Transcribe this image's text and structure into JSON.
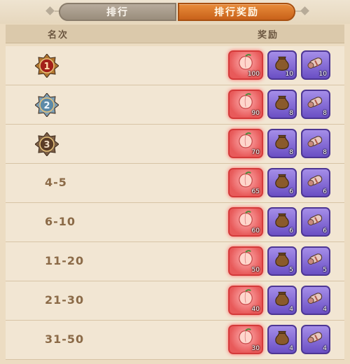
{
  "tabs": [
    {
      "label": "排行",
      "active": false
    },
    {
      "label": "排行奖励",
      "active": true
    }
  ],
  "header": {
    "rank": "名次",
    "reward": "奖励"
  },
  "rows": [
    {
      "rank": "1",
      "medal": "gold",
      "rewards": [
        {
          "icon": "peach-icon",
          "count": "100"
        },
        {
          "icon": "sack-icon",
          "count": "10"
        },
        {
          "icon": "scroll-icon",
          "count": "10"
        }
      ]
    },
    {
      "rank": "2",
      "medal": "silver",
      "rewards": [
        {
          "icon": "peach-icon",
          "count": "90"
        },
        {
          "icon": "sack-icon",
          "count": "8"
        },
        {
          "icon": "scroll-icon",
          "count": "8"
        }
      ]
    },
    {
      "rank": "3",
      "medal": "bronze",
      "rewards": [
        {
          "icon": "peach-icon",
          "count": "70"
        },
        {
          "icon": "sack-icon",
          "count": "8"
        },
        {
          "icon": "scroll-icon",
          "count": "8"
        }
      ]
    },
    {
      "rank": "4-5",
      "rewards": [
        {
          "icon": "peach-icon",
          "count": "65"
        },
        {
          "icon": "sack-icon",
          "count": "6"
        },
        {
          "icon": "scroll-icon",
          "count": "6"
        }
      ]
    },
    {
      "rank": "6-10",
      "rewards": [
        {
          "icon": "peach-icon",
          "count": "60"
        },
        {
          "icon": "sack-icon",
          "count": "6"
        },
        {
          "icon": "scroll-icon",
          "count": "6"
        }
      ]
    },
    {
      "rank": "11-20",
      "rewards": [
        {
          "icon": "peach-icon",
          "count": "50"
        },
        {
          "icon": "sack-icon",
          "count": "5"
        },
        {
          "icon": "scroll-icon",
          "count": "5"
        }
      ]
    },
    {
      "rank": "21-30",
      "rewards": [
        {
          "icon": "peach-icon",
          "count": "40"
        },
        {
          "icon": "sack-icon",
          "count": "4"
        },
        {
          "icon": "scroll-icon",
          "count": "4"
        }
      ]
    },
    {
      "rank": "31-50",
      "rewards": [
        {
          "icon": "peach-icon",
          "count": "30"
        },
        {
          "icon": "sack-icon",
          "count": "4"
        },
        {
          "icon": "scroll-icon",
          "count": "4"
        }
      ]
    }
  ],
  "colors": {
    "tab_active": "#d9721f",
    "reward_highlight": "#e85a5a",
    "reward_purple": "#7b5fd0"
  }
}
